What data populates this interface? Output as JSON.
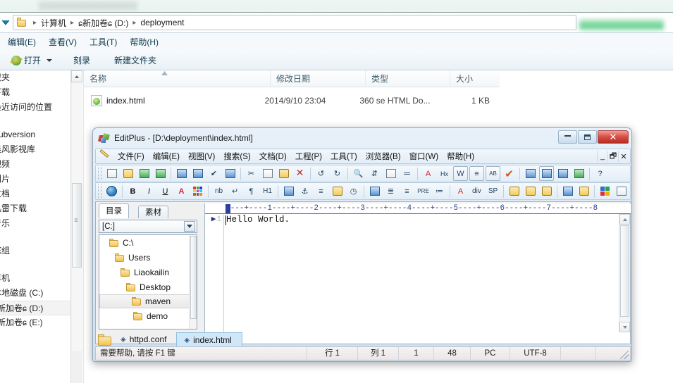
{
  "explorer": {
    "address": {
      "crumbs": [
        "计算机",
        "ɕ新加卷ɕ (D:)",
        "deployment"
      ],
      "separator": "▸"
    },
    "menu": [
      "编辑(E)",
      "查看(V)",
      "工具(T)",
      "帮助(H)"
    ],
    "commands": {
      "open": "打开",
      "burn": "刻录",
      "new_folder": "新建文件夹"
    },
    "nav_items": [
      "藏夹",
      "下载",
      "最近访问的位置",
      "",
      "Subversion",
      "晨风影视库",
      "视频",
      "图片",
      "文档",
      "迅雷下载",
      "音乐",
      "",
      "庭组",
      "",
      "算机",
      "本地磁盘 (C:)",
      "ɕ新加卷ɕ (D:)",
      "ɕ新加卷ɕ (E:)"
    ],
    "selected_nav_index": 16,
    "columns": [
      "名称",
      "修改日期",
      "类型",
      "大小"
    ],
    "rows": [
      {
        "name": "index.html",
        "modified": "2014/9/10 23:04",
        "type": "360 se HTML Do...",
        "size": "1 KB"
      }
    ]
  },
  "editplus": {
    "title": "EditPlus - [D:\\deployment\\index.html]",
    "window_buttons": {
      "minimize": "—",
      "maximize": "▣",
      "close": "✕"
    },
    "mdi_buttons": {
      "minimize": "_",
      "restore": "🗗",
      "close": "✕"
    },
    "menu": [
      "文件(F)",
      "编辑(E)",
      "视图(V)",
      "搜索(S)",
      "文档(D)",
      "工程(P)",
      "工具(T)",
      "浏览器(B)",
      "窗口(W)",
      "帮助(H)"
    ],
    "toolbar_row1": [
      "new-file-icon",
      "open-file-icon",
      "save-icon",
      "save-all-icon",
      "print-preview-icon",
      "print-icon",
      "spellcheck-icon",
      "view-source-icon",
      "cut-icon",
      "copy-icon",
      "paste-icon",
      "delete-icon",
      "undo-icon",
      "redo-icon",
      "find-icon",
      "replace-icon",
      "find-in-files-icon",
      "sort-icon",
      "font-icon",
      "hex-icon",
      "word-wrap-icon",
      "line-numbers-icon",
      "uppercase-icon",
      "check-icon",
      "user-tool1-icon",
      "user-tool2-icon",
      "user-tool3-icon",
      "user-tool4-icon",
      "help-pointer-icon"
    ],
    "toolbar_row2": [
      "browser-preview-icon",
      "bold-icon",
      "italic-icon",
      "underline-icon",
      "font-color-icon",
      "color-palette-icon",
      "nbsp-icon",
      "line-break-icon",
      "paragraph-icon",
      "heading-icon",
      "image-icon",
      "anchor-icon",
      "horizontal-rule-icon",
      "edit-pencil-icon",
      "clock-icon",
      "table-icon",
      "align-left-icon",
      "align-center-icon",
      "preformatted-icon",
      "list-icon",
      "font-tag-icon",
      "div-icon",
      "sp-icon",
      "script-icon",
      "comment-icon",
      "link-icon",
      "form-icon",
      "frame-icon",
      "color-grid-icon",
      "template-icon"
    ],
    "directory_pane": {
      "tabs": [
        "目录",
        "素材"
      ],
      "active_tab": "目录",
      "drive_selector": "[C:]",
      "tree": [
        {
          "label": "C:\\",
          "indent": 0,
          "selected": false
        },
        {
          "label": "Users",
          "indent": 1,
          "selected": false
        },
        {
          "label": "Liaokailin",
          "indent": 2,
          "selected": false
        },
        {
          "label": "Desktop",
          "indent": 3,
          "selected": false
        },
        {
          "label": "maven",
          "indent": 4,
          "selected": true
        },
        {
          "label": "demo",
          "indent": 5,
          "selected": false
        }
      ]
    },
    "editor": {
      "ruler": "----+----1----+----2----+----3----+----4----+----5----+----6----+----7----+----8",
      "lines": [
        {
          "number": "1",
          "text": "Hello World."
        }
      ]
    },
    "doc_tabs": [
      {
        "label": "httpd.conf",
        "active": false
      },
      {
        "label": "index.html",
        "active": true
      }
    ],
    "status": {
      "hint": "需要帮助, 请按 F1 键",
      "row": "行 1",
      "col": "列 1",
      "char": "1",
      "length": "48",
      "platform": "PC",
      "encoding": "UTF-8"
    }
  },
  "colors": {
    "accent_blue": "#2b3f9e",
    "tab_active": "#cfe7f7",
    "close_red": "#b62b22",
    "folder_yellow": "#f2c350",
    "redact_green": "#50c882"
  }
}
